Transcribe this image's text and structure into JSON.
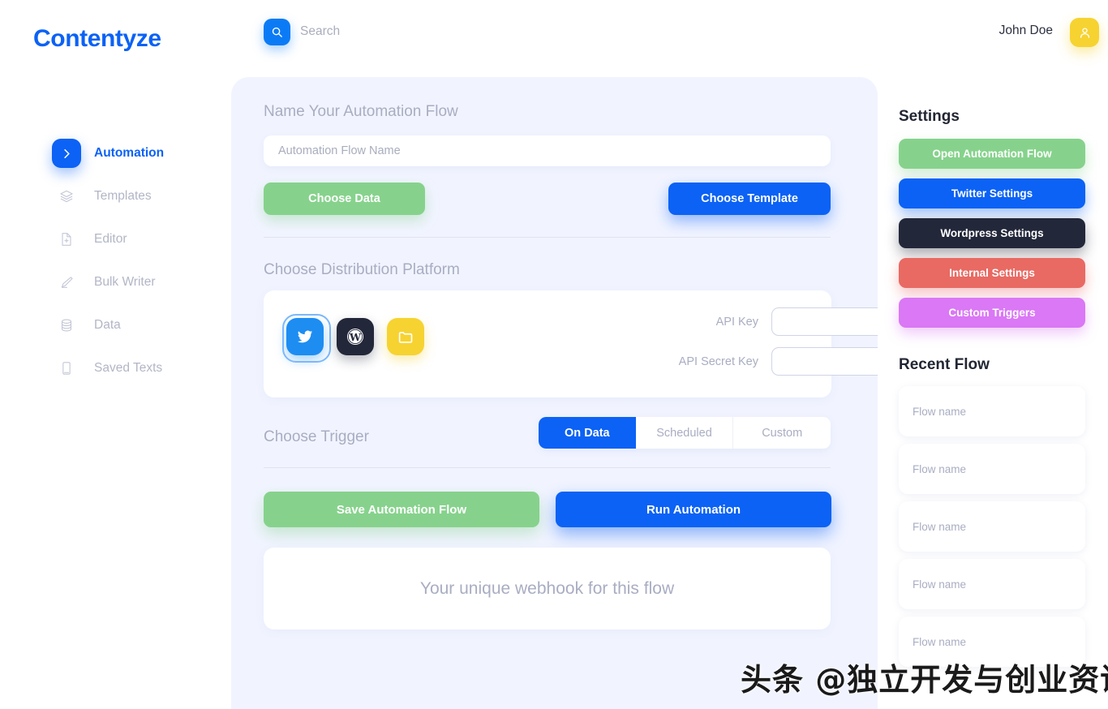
{
  "brand": {
    "name": "Contentyze",
    "color": "#0b62f5"
  },
  "topbar": {
    "search": {
      "icon": "search-icon",
      "placeholder": "Search",
      "value": ""
    },
    "user": {
      "name": "John Doe",
      "avatar_icon": "user-icon",
      "avatar_color": "#f6d331"
    }
  },
  "sidebar": {
    "items": [
      {
        "label": "Automation",
        "icon": "chevron-right-icon",
        "active": true
      },
      {
        "label": "Templates",
        "icon": "layers-icon",
        "active": false
      },
      {
        "label": "Editor",
        "icon": "document-plus-icon",
        "active": false
      },
      {
        "label": "Bulk Writer",
        "icon": "pen-icon",
        "active": false
      },
      {
        "label": "Data",
        "icon": "database-icon",
        "active": false
      },
      {
        "label": "Saved Texts",
        "icon": "book-icon",
        "active": false
      }
    ]
  },
  "main": {
    "name_section": {
      "title": "Name Your Automation Flow",
      "input_placeholder": "Automation Flow Name",
      "input_value": "",
      "choose_data_label": "Choose Data",
      "choose_data_color": "#86d28c",
      "choose_template_label": "Choose Template",
      "choose_template_color": "#0b62f5"
    },
    "platform_section": {
      "title": "Choose Distribution Platform",
      "platforms": [
        {
          "name": "Twitter",
          "icon": "twitter-icon",
          "color": "#1d8df2",
          "selected": true
        },
        {
          "name": "Wordpress",
          "icon": "wordpress-icon",
          "color": "#23273a",
          "selected": false
        },
        {
          "name": "Folder",
          "icon": "folder-icon",
          "color": "#f6d331",
          "selected": false
        }
      ],
      "api_key_label": "API Key",
      "api_key_value": "",
      "api_secret_label": "API Secret Key",
      "api_secret_value": ""
    },
    "trigger_section": {
      "title": "Choose Trigger",
      "options": [
        {
          "label": "On Data",
          "active": true
        },
        {
          "label": "Scheduled",
          "active": false
        },
        {
          "label": "Custom",
          "active": false
        }
      ]
    },
    "actions": {
      "save_label": "Save Automation Flow",
      "save_color": "#86d28c",
      "run_label": "Run Automation",
      "run_color": "#0b62f5"
    },
    "webhook": {
      "text": "Your unique webhook for this flow"
    }
  },
  "right_panel": {
    "settings_heading": "Settings",
    "settings_buttons": [
      {
        "label": "Open Automation Flow",
        "color": "#86d28c"
      },
      {
        "label": "Twitter Settings",
        "color": "#0b62f5"
      },
      {
        "label": "Wordpress Settings",
        "color": "#23273a"
      },
      {
        "label": "Internal Settings",
        "color": "#e86a63"
      },
      {
        "label": "Custom Triggers",
        "color": "#da78f5"
      }
    ],
    "recent_heading": "Recent Flow",
    "recent_flows": [
      {
        "name": "Flow name"
      },
      {
        "name": "Flow name"
      },
      {
        "name": "Flow name"
      },
      {
        "name": "Flow name"
      },
      {
        "name": "Flow name"
      }
    ]
  },
  "watermark": {
    "text": "头条 @独立开发与创业资讯"
  }
}
